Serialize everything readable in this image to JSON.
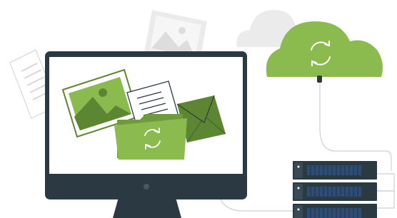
{
  "colors": {
    "accent_green": "#8bbb4f",
    "dark_green": "#5c8631",
    "monitor_frame": "#2b3942",
    "screen": "#ffffff",
    "faded_gray": "#ebebeb",
    "server_blue": "#2c4d7a"
  },
  "icons": {
    "cloud": "cloud-sync-icon",
    "folder": "folder-sync-icon",
    "sync": "sync-arrows-icon",
    "image": "image-icon",
    "document": "document-icon",
    "envelope": "envelope-icon",
    "server": "server-rack-icon"
  }
}
